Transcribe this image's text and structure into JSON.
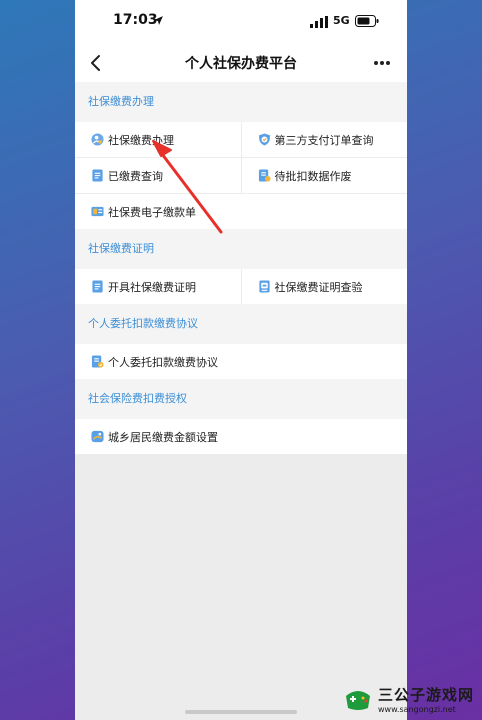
{
  "status_bar": {
    "time": "17:03",
    "network": "5G"
  },
  "nav": {
    "title": "个人社保办费平台"
  },
  "sections": [
    {
      "header": "社保缴费办理",
      "rows": [
        [
          {
            "label": "社保缴费办理",
            "icon": "person-pay-icon"
          },
          {
            "label": "第三方支付订单查询",
            "icon": "shield-check-icon"
          }
        ],
        [
          {
            "label": "已缴费查询",
            "icon": "document-icon"
          },
          {
            "label": "待批扣数据作废",
            "icon": "document-alert-icon"
          }
        ],
        [
          {
            "label": "社保费电子缴款单",
            "icon": "receipt-icon"
          }
        ]
      ]
    },
    {
      "header": "社保缴费证明",
      "rows": [
        [
          {
            "label": "开具社保缴费证明",
            "icon": "document-icon"
          },
          {
            "label": "社保缴费证明查验",
            "icon": "verify-icon"
          }
        ]
      ]
    },
    {
      "header": "个人委托扣款缴费协议",
      "rows": [
        [
          {
            "label": "个人委托扣款缴费协议",
            "icon": "agreement-icon"
          }
        ]
      ]
    },
    {
      "header": "社会保险费扣费授权",
      "rows": [
        [
          {
            "label": "城乡居民缴费金额设置",
            "icon": "wallet-icon"
          }
        ]
      ]
    }
  ],
  "watermark": {
    "title": "三公子游戏网",
    "url": "www.sangongzi.net"
  },
  "colors": {
    "accent": "#3d8fd6",
    "arrow": "#e8302a"
  }
}
